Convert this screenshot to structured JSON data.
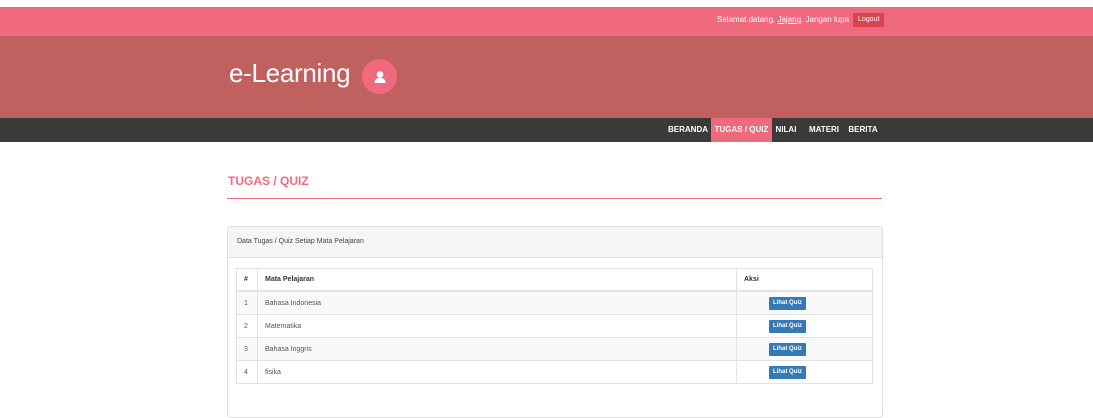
{
  "topbar": {
    "welcome_prefix": "Selamat datang, ",
    "username": "Jajang",
    "welcome_suffix": ". Jangan lupa",
    "logout_label": "Logout"
  },
  "header": {
    "brand": "e-Learning",
    "avatar_icon": "user-icon"
  },
  "nav": {
    "items": [
      {
        "label": "BERANDA",
        "active": false
      },
      {
        "label": "TUGAS / QUIZ",
        "active": true
      },
      {
        "label": "NILAI",
        "active": false
      },
      {
        "label": "MATERI",
        "active": false
      },
      {
        "label": "BERITA",
        "active": false
      }
    ]
  },
  "page": {
    "title": "TUGAS / QUIZ"
  },
  "panel": {
    "heading": "Data Tugas / Quiz Setiap Mata Pelajaran",
    "columns": [
      "#",
      "Mata Pelajaran",
      "Aksi"
    ],
    "rows": [
      {
        "no": "1",
        "subject": "Bahasa Indonesia",
        "action": "Lihat Quiz"
      },
      {
        "no": "2",
        "subject": "Matematika",
        "action": "Lihat Quiz"
      },
      {
        "no": "3",
        "subject": "Bahasa Inggris",
        "action": "Lihat Quiz"
      },
      {
        "no": "4",
        "subject": "fisika",
        "action": "Lihat Quiz"
      }
    ]
  },
  "colors": {
    "pink": "#f06a7e",
    "header": "#c0605f",
    "navbar": "#3a3a3a",
    "button": "#337ab7"
  }
}
